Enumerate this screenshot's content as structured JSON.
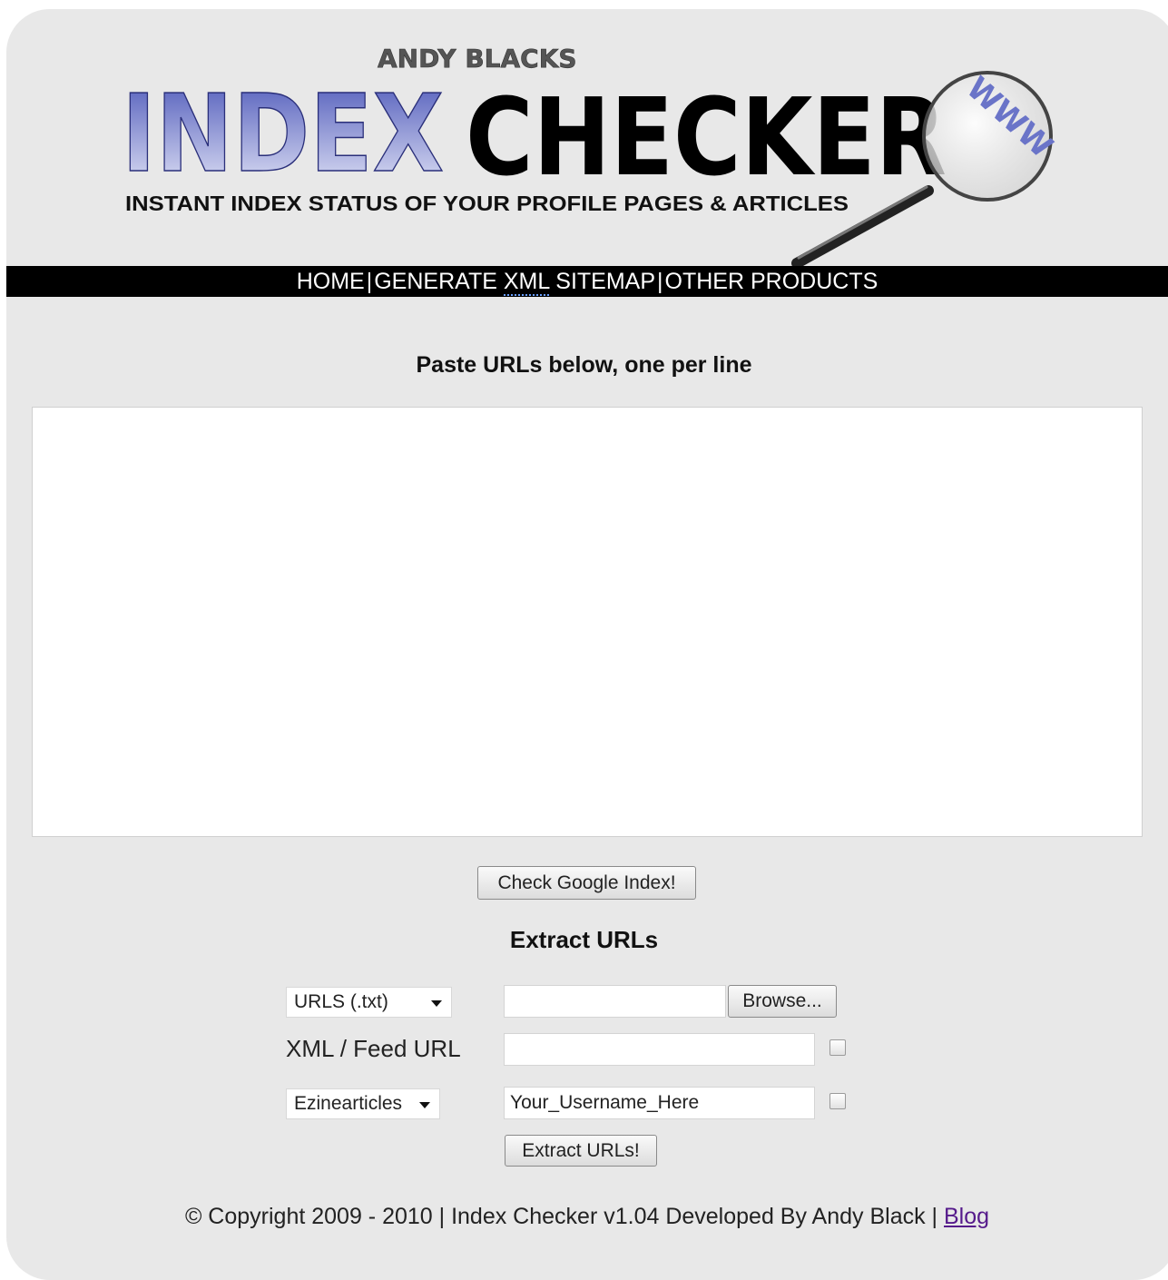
{
  "header": {
    "logo_top": "ANDY BLACKS",
    "logo_index": "INDEX",
    "logo_checker": "CHECKER",
    "logo_www": "WWW",
    "tagline": "INSTANT INDEX STATUS OF YOUR PROFILE PAGES & ARTICLES"
  },
  "nav": {
    "home": "HOME",
    "generate_xml_pre": "GENERATE ",
    "generate_xml_word": "XML",
    "generate_xml_post": " SITEMAP",
    "other": "OTHER PRODUCTS",
    "separator": "|"
  },
  "main": {
    "paste_label": "Paste URLs below, one per line",
    "urls_value": "",
    "check_button": "Check Google Index!"
  },
  "extract": {
    "title": "Extract URLs",
    "file_type_select": "URLS (.txt)",
    "file_value": "",
    "browse_button": "Browse...",
    "feed_label": "XML / Feed URL",
    "feed_value": "",
    "feed_checked": false,
    "site_select": "Ezinearticles",
    "username_value": "Your_Username_Here",
    "username_checked": false,
    "extract_button": "Extract URLs!"
  },
  "footer": {
    "text": "© Copyright 2009 - 2010 | Index Checker v1.04 Developed By Andy Black | ",
    "blog_link": "Blog"
  },
  "colors": {
    "background": "#e8e8e8",
    "navbar": "#000000",
    "index_gradient_top": "#4a55b8",
    "index_gradient_bottom": "#e6e8f8",
    "link_visited": "#551a8b"
  }
}
